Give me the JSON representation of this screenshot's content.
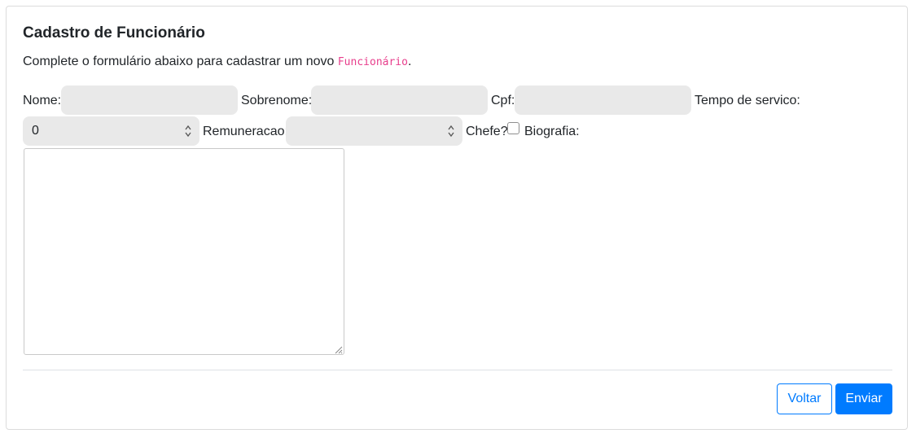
{
  "form": {
    "title": "Cadastro de Funcionário",
    "description_prefix": "Complete o formulário abaixo para cadastrar um novo ",
    "description_code": "Funcionário",
    "description_suffix": ".",
    "fields": {
      "nome_label": "Nome:",
      "nome_value": "",
      "sobrenome_label": "Sobrenome:",
      "sobrenome_value": "",
      "cpf_label": "Cpf:",
      "cpf_value": "",
      "tempo_label": "Tempo de servico:",
      "tempo_value": "0",
      "remuneracao_label": "Remuneracao:",
      "remuneracao_value": "",
      "chefe_label": "Chefe?",
      "chefe_checked": false,
      "biografia_label": "Biografia:",
      "biografia_value": ""
    },
    "buttons": {
      "back_label": "Voltar",
      "submit_label": "Enviar"
    }
  },
  "icons": {
    "spinner": "spinner-arrows-icon",
    "resize": "resize-handle-icon"
  },
  "colors": {
    "primary": "#007bff",
    "code": "#e83e8c",
    "field_bg": "#e9e9e9"
  }
}
